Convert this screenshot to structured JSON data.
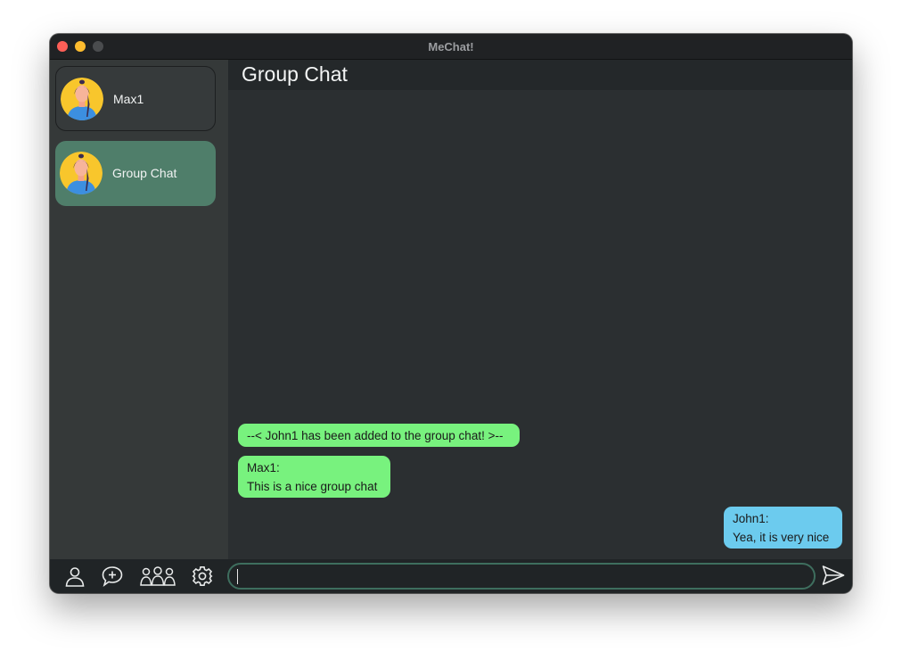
{
  "window": {
    "title": "MeChat!"
  },
  "sidebar": {
    "contacts": [
      {
        "name": "Max1",
        "avatar_icon": "person-avatar-icon",
        "selected": false
      },
      {
        "name": "Group Chat",
        "avatar_icon": "person-avatar-icon",
        "selected": true
      }
    ]
  },
  "chat": {
    "title": "Group Chat",
    "messages": [
      {
        "type": "system",
        "text": "--< John1 has been added to the group chat! >--"
      },
      {
        "type": "incoming",
        "sender": "Max1:",
        "text": "This is a nice group chat"
      },
      {
        "type": "outgoing",
        "sender": "John1:",
        "text": "Yea, it is very nice"
      }
    ]
  },
  "toolbar": {
    "icons": [
      "profile-icon",
      "new-chat-icon",
      "group-icon",
      "settings-icon"
    ],
    "message_value": "",
    "send_icon": "send-icon"
  },
  "colors": {
    "incoming_bubble": "#78f27e",
    "outgoing_bubble": "#6ccbee",
    "selected_contact": "#4f7e6a",
    "input_border": "#3e6e5e"
  }
}
